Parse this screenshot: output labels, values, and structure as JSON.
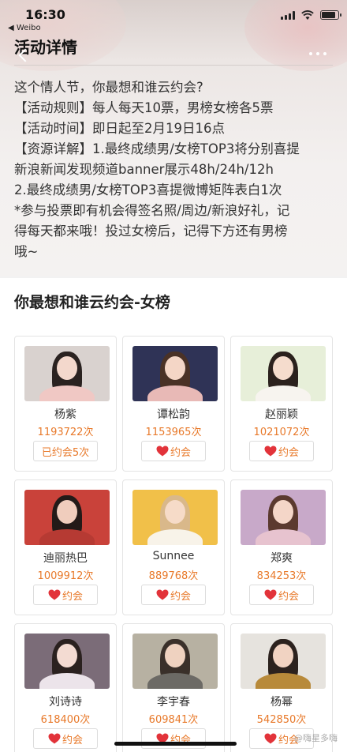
{
  "status_bar": {
    "time": "16:30",
    "back_app": "◀ Weibo"
  },
  "header": {
    "title": "活动详情"
  },
  "description": [
    "这个情人节，你最想和谁云约会?",
    "【活动规则】每人每天10票，男榜女榜各5票",
    "【活动时间】即日起至2月19日16点",
    "【资源详解】1.最终成绩男/女榜TOP3将分别喜提",
    "新浪新闻发现频道banner展示48h/24h/12h",
    "2.最终成绩男/女榜TOP3喜提微博矩阵表白1次",
    "*参与投票即有机会得签名照/周边/新浪好礼，记",
    "得每天都来哦！投过女榜后，记得下方还有男榜",
    "哦~"
  ],
  "section": {
    "title": "你最想和谁云约会-女榜"
  },
  "cards": [
    {
      "name": "杨紫",
      "votes": "1193722次",
      "button": "已约会5次",
      "voted": true,
      "photo": {
        "bg": "#d9d2cf",
        "hair": "#2a2220",
        "skin": "#f3d8cc",
        "body": "#f0c8c4"
      }
    },
    {
      "name": "谭松韵",
      "votes": "1153965次",
      "button": "约会",
      "voted": false,
      "photo": {
        "bg": "#2f3356",
        "hair": "#4a3226",
        "skin": "#f4d6c6",
        "body": "#e8b9b6"
      }
    },
    {
      "name": "赵丽颖",
      "votes": "1021072次",
      "button": "约会",
      "voted": false,
      "photo": {
        "bg": "#e7efd9",
        "hair": "#2b211d",
        "skin": "#f5dccd",
        "body": "#f7f4ef"
      }
    },
    {
      "name": "迪丽热巴",
      "votes": "1009912次",
      "button": "约会",
      "voted": false,
      "photo": {
        "bg": "#c9423a",
        "hair": "#231a18",
        "skin": "#f0cdbd",
        "body": "#b63a33"
      }
    },
    {
      "name": "Sunnee",
      "votes": "889768次",
      "button": "约会",
      "voted": false,
      "photo": {
        "bg": "#f1c049",
        "hair": "#d9b88a",
        "skin": "#f6dbc8",
        "body": "#f8f3e9"
      }
    },
    {
      "name": "郑爽",
      "votes": "834253次",
      "button": "约会",
      "voted": false,
      "photo": {
        "bg": "#c8a9c9",
        "hair": "#5b3a2f",
        "skin": "#f4d6c8",
        "body": "#e7c3cf"
      }
    },
    {
      "name": "刘诗诗",
      "votes": "618400次",
      "button": "约会",
      "voted": false,
      "photo": {
        "bg": "#7b6c78",
        "hair": "#2a211f",
        "skin": "#f3dbd2",
        "body": "#ece4ea"
      }
    },
    {
      "name": "李宇春",
      "votes": "609841次",
      "button": "约会",
      "voted": false,
      "photo": {
        "bg": "#b7b1a2",
        "hair": "#3a302a",
        "skin": "#efd2c0",
        "body": "#6c6a65"
      }
    },
    {
      "name": "杨幂",
      "votes": "542850次",
      "button": "约会",
      "voted": false,
      "photo": {
        "bg": "#e6e3de",
        "hair": "#2c221e",
        "skin": "#f1d3c2",
        "body": "#b88a3a"
      }
    }
  ],
  "watermark": "@嗨星多嗨",
  "colors": {
    "accent": "#e8792a",
    "heart": "#e2333a"
  }
}
